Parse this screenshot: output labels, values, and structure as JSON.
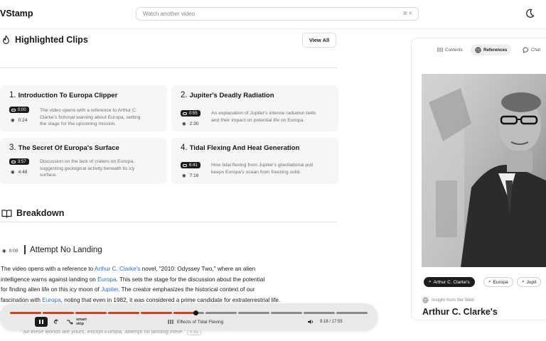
{
  "header": {
    "logo": "VStamp",
    "search_placeholder": "Watch another video",
    "search_shortcut": "⌘ K"
  },
  "highlights": {
    "title": "Highlighted Clips",
    "view_all": "View All",
    "clips": [
      {
        "num": "1.",
        "title": "Introduction To Europa Clipper",
        "timestamp": "0:00",
        "views": "0:24",
        "desc": [
          "The video opens with a reference to Arthur C.",
          "Clarke's fictional warning about Europa, setting",
          "the stage for the upcoming mission."
        ]
      },
      {
        "num": "2.",
        "title": "Jupiter's Deadly Radiation",
        "timestamp": "0:55",
        "views": "2:30",
        "desc": [
          "An explanation of Jupiter's intense radiation belts",
          "and their impact on potential life on Europa."
        ]
      },
      {
        "num": "3.",
        "title": "The Secret Of Europa's Surface",
        "timestamp": "3:57",
        "views": "4:48",
        "desc": [
          "Discussion on the lack of craters on Europa,",
          "suggesting geological activity beneath its icy",
          "surface."
        ]
      },
      {
        "num": "4.",
        "title": "Tidal Flexing And Heat Generation",
        "timestamp": "6:41",
        "views": "7:16",
        "desc": [
          "How tidal flexing from Jupiter's gravitational pull",
          "keeps Europa's ocean from freezing solid."
        ]
      }
    ]
  },
  "breakdown": {
    "title": "Breakdown",
    "section_time": "0:00",
    "section_title": "Attempt No Landing",
    "para": {
      "l1a": "The video opens with a reference to ",
      "l1link": "Arthur C. Clarke's",
      "l1b": " novel, \"2010: Odyssey Two,\" where an alien",
      "l2a": "intelligence warns against landing on ",
      "l2link": "Europa",
      "l2b": ". This sets the stage for the discussion about the potential",
      "l3a": "for finding alien life on this icy moon of ",
      "l3link": "Jupiter",
      "l3b": ". The creator emphasizes the historical context of our",
      "l4a": "fascination with ",
      "l4link": "Europa",
      "l4b": ", noting that even in 1982, it was considered a prime candidate for extraterrestrial life."
    },
    "quote": "\"All these worlds are yours, except Europa, attempt no landing there.\"",
    "quote_time": "0:15"
  },
  "player": {
    "smart_skip": [
      "smart",
      "skip"
    ],
    "chapter": "Effects of Tidal Flexing",
    "time": "9:18 / 17:55",
    "played_fraction": 0.52
  },
  "panel": {
    "tabs": [
      {
        "label": "Contents"
      },
      {
        "label": "References"
      },
      {
        "label": "Chat"
      }
    ],
    "chips": [
      {
        "label": "Arthur C. Clarke's"
      },
      {
        "label": "Europa"
      },
      {
        "label": "Jupit"
      }
    ],
    "insight": "Insight from the Web",
    "ref_title": "Arthur C. Clarke's"
  },
  "colors": {
    "played": "#d63a2f",
    "unplayed": "#8a8a8a",
    "link": "#2d6ccf"
  }
}
